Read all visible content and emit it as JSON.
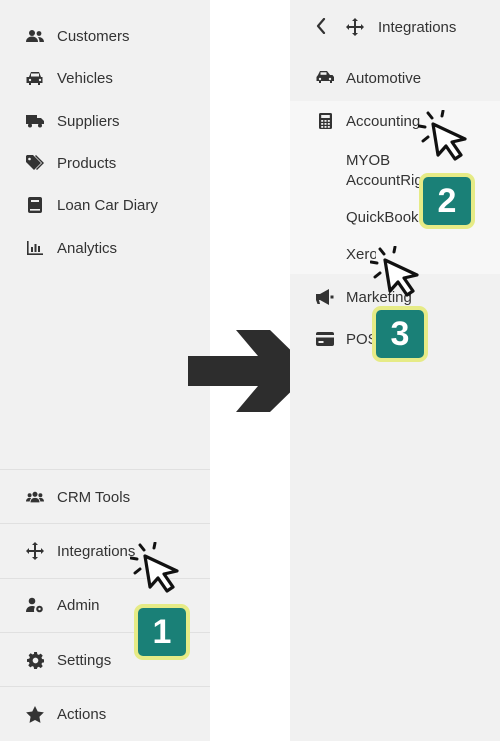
{
  "left_nav": {
    "items": [
      {
        "label": "Customers",
        "icon": "users-icon"
      },
      {
        "label": "Vehicles",
        "icon": "car-icon"
      },
      {
        "label": "Suppliers",
        "icon": "truck-icon"
      },
      {
        "label": "Products",
        "icon": "tags-icon"
      },
      {
        "label": "Loan Car Diary",
        "icon": "book-icon"
      },
      {
        "label": "Analytics",
        "icon": "chart-bar-icon"
      }
    ],
    "bottom_items": [
      {
        "label": "CRM Tools",
        "icon": "users-group-icon"
      },
      {
        "label": "Integrations",
        "icon": "arrows-move-icon"
      },
      {
        "label": "Admin",
        "icon": "user-cog-icon"
      },
      {
        "label": "Settings",
        "icon": "gear-icon"
      },
      {
        "label": "Actions",
        "icon": "star-icon"
      }
    ]
  },
  "integrations_panel": {
    "title": "Integrations",
    "items": [
      {
        "label": "Automotive",
        "icon": "car-side-icon"
      },
      {
        "label": "Accounting",
        "icon": "calculator-icon"
      },
      {
        "label": "Marketing",
        "icon": "megaphone-icon"
      },
      {
        "label": "POS",
        "icon": "credit-card-icon"
      }
    ],
    "accounting_sub": [
      "MYOB AccountRight",
      "QuickBooks",
      "Xero"
    ]
  },
  "steps": [
    "1",
    "2",
    "3"
  ],
  "colors": {
    "badge_fill": "#1a8077",
    "badge_border": "#e6eb86",
    "panel_bg": "#f1f1f1",
    "arrow": "#2d2d2d"
  }
}
